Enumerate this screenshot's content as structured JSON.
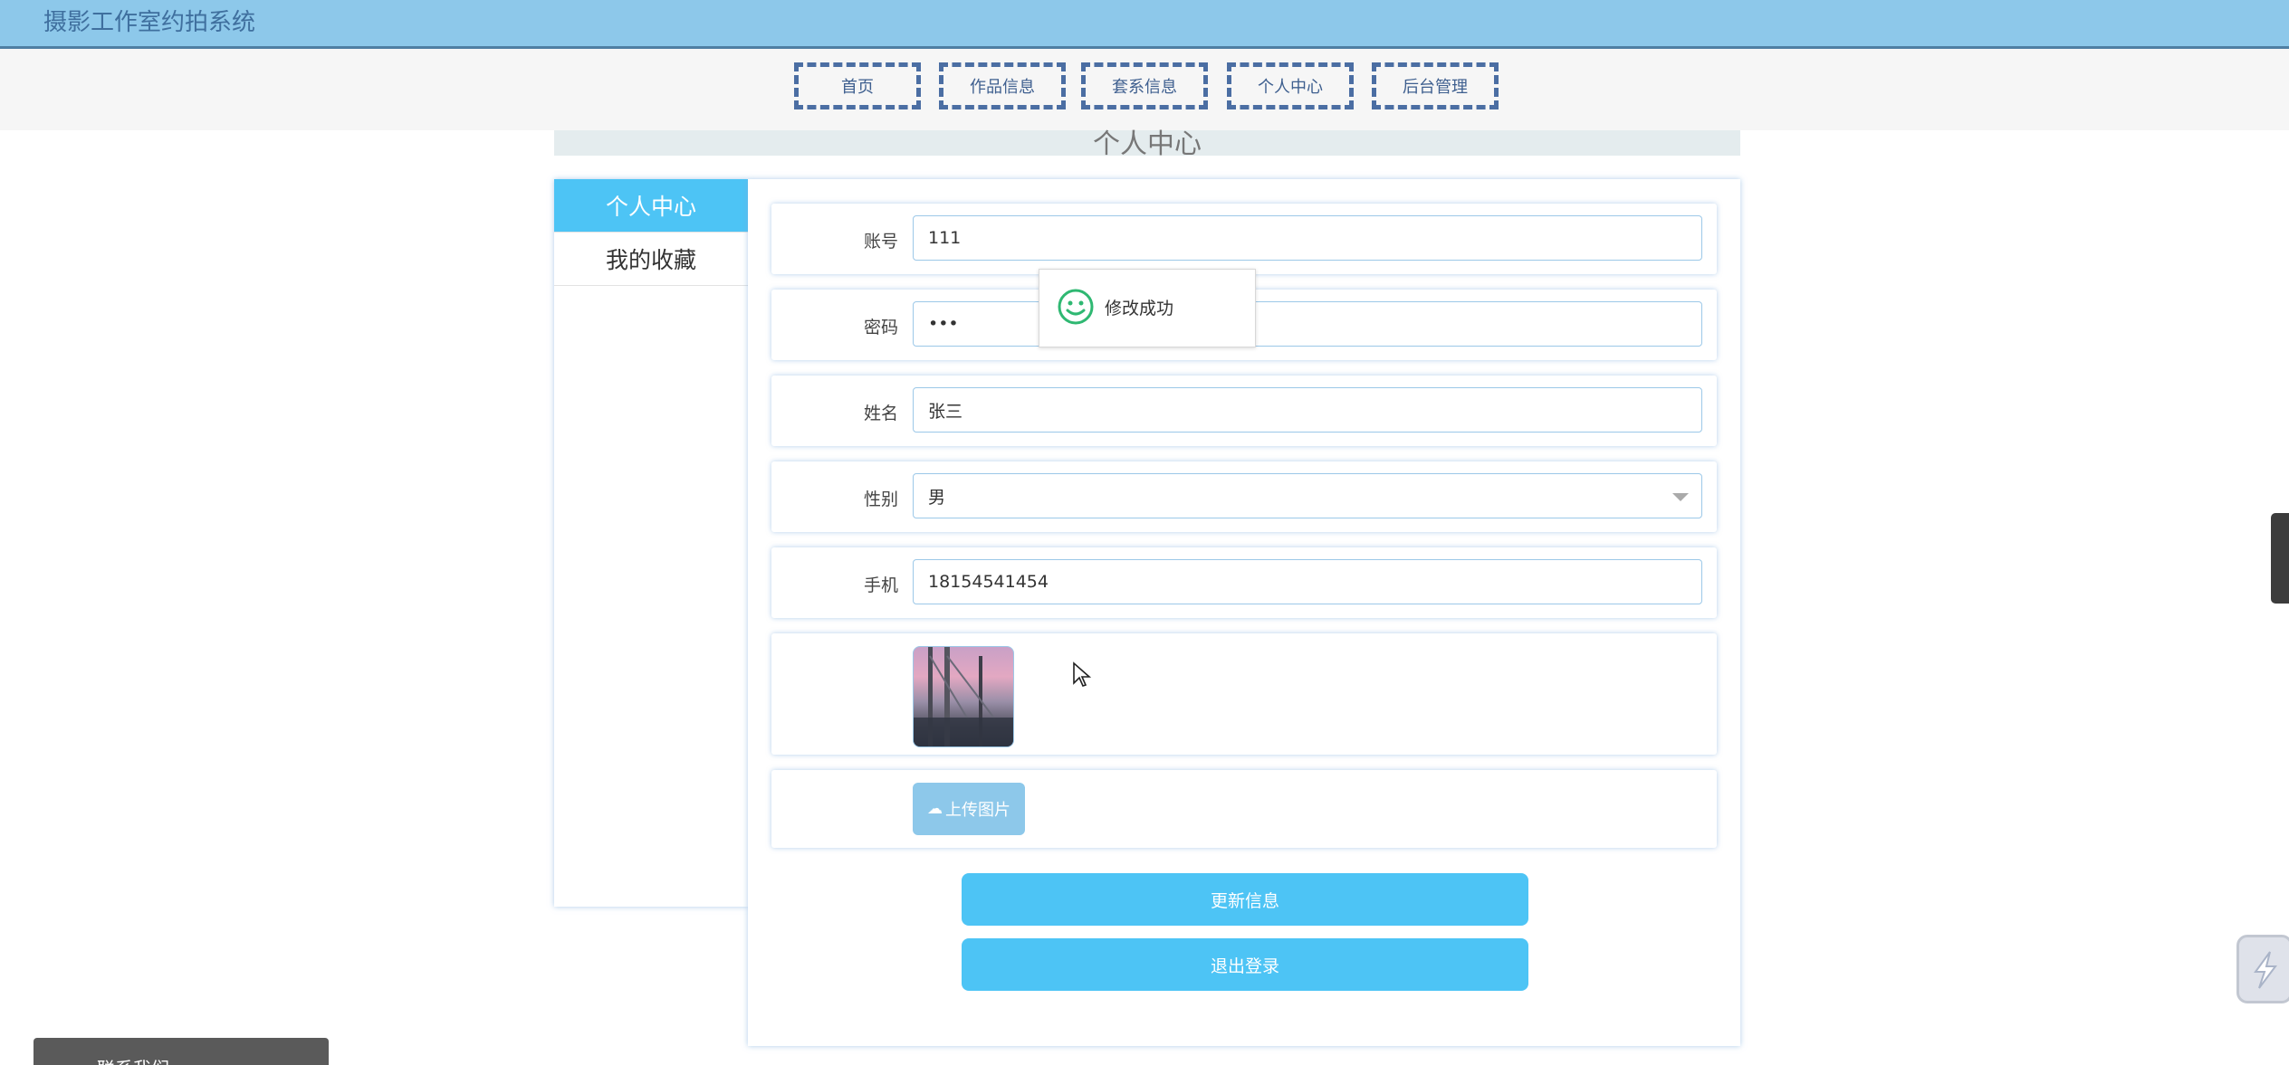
{
  "app": {
    "title": "摄影工作室约拍系统"
  },
  "nav": {
    "items": [
      "首页",
      "作品信息",
      "套系信息",
      "个人中心",
      "后台管理"
    ]
  },
  "page": {
    "heading": "个人中心"
  },
  "sidebar": {
    "items": [
      "个人中心",
      "我的收藏"
    ],
    "active_index": 0
  },
  "form": {
    "account": {
      "label": "账号",
      "value": "111"
    },
    "password": {
      "label": "密码",
      "value": "•••"
    },
    "name": {
      "label": "姓名",
      "value": "张三"
    },
    "gender": {
      "label": "性别",
      "value": "男"
    },
    "phone": {
      "label": "手机",
      "value": "18154541454"
    },
    "upload_label": "上传图片",
    "update_button": "更新信息",
    "logout_button": "退出登录"
  },
  "toast": {
    "message": "修改成功"
  },
  "bottom_bar": {
    "text": "联系我们"
  },
  "colors": {
    "header_bg": "#8dc8ea",
    "accent": "#4dc4f5",
    "nav_border": "#4b6ea3",
    "toast_icon": "#2fb872"
  }
}
